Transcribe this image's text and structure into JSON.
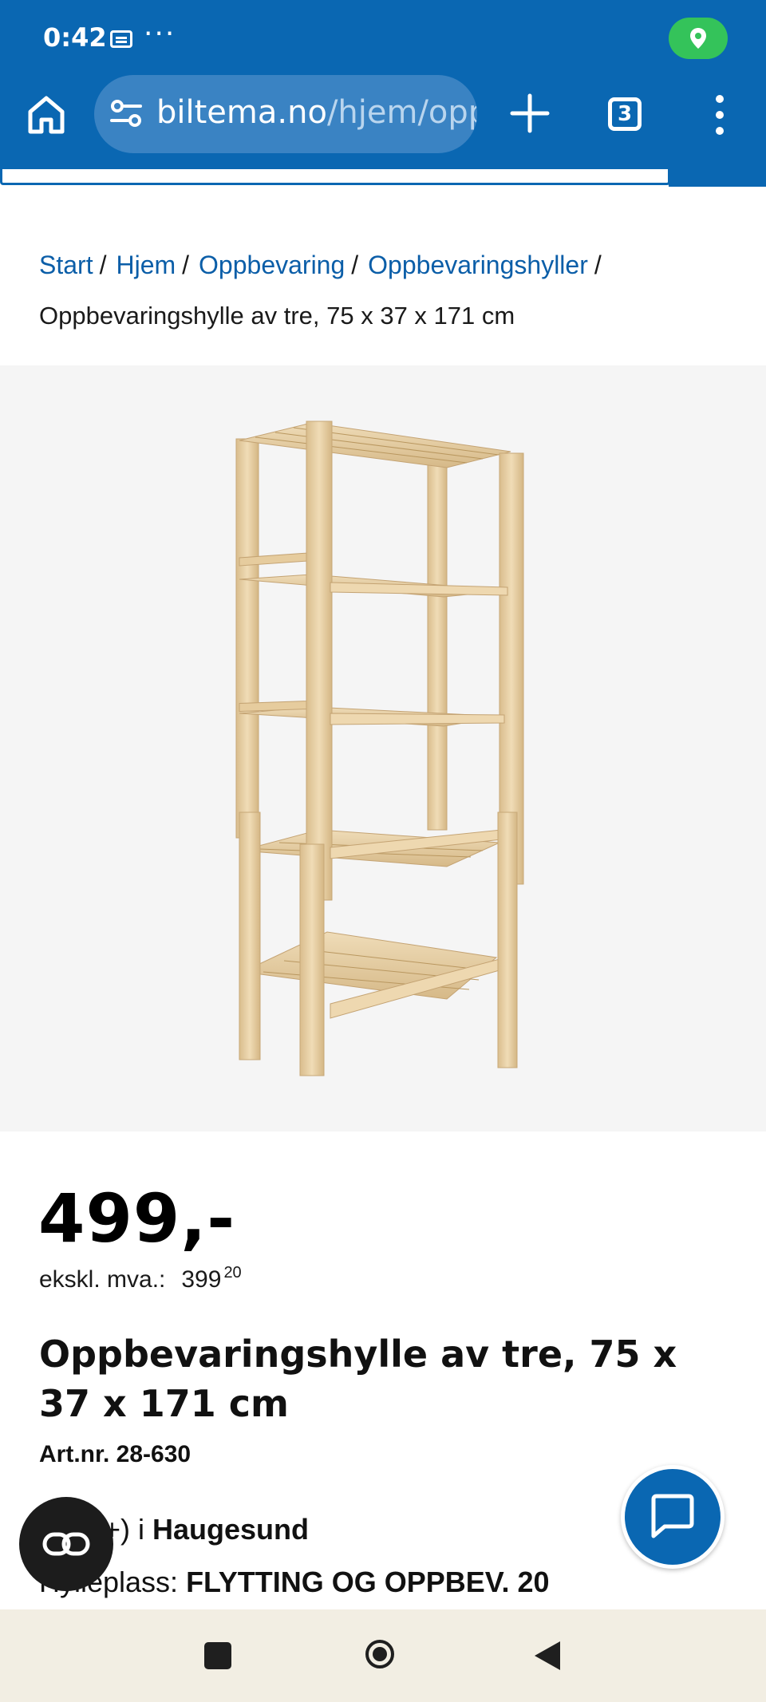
{
  "status_bar": {
    "time": "0:42",
    "overflow": "···"
  },
  "browser": {
    "url_host": "biltema.no",
    "url_path": "/hjem/oppb",
    "tab_count": "3"
  },
  "breadcrumb": {
    "items": [
      "Start",
      "Hjem",
      "Oppbevaring",
      "Oppbevaringshyller"
    ],
    "separator": "/",
    "current": "Oppbevaringshylle av tre, 75 x 37 x 171 cm"
  },
  "product": {
    "price": "499,-",
    "ex_vat_label": "ekskl. mva.:",
    "ex_vat_main": "399",
    "ex_vat_cents": "20",
    "title": "Oppbevaringshylle av tre, 75 x 37 x 171 cm",
    "art_nr": "Art.nr. 28-630",
    "stock_prefix": "+) i ",
    "stock_store": "Haugesund",
    "shelf_prefix": "Hylleplass: ",
    "shelf_location": "FLYTTING OG OPPBEV. 20"
  },
  "colors": {
    "brand_blue": "#0a67b2",
    "link_blue": "#0b5ea8",
    "location_green": "#34c35a",
    "wood": "#e8d2a8"
  },
  "icons": {
    "home": "home-icon",
    "tune": "tune-icon",
    "plus": "plus-icon",
    "menu": "more-vert-icon",
    "chat": "chat-icon",
    "compare": "compare-icon"
  }
}
